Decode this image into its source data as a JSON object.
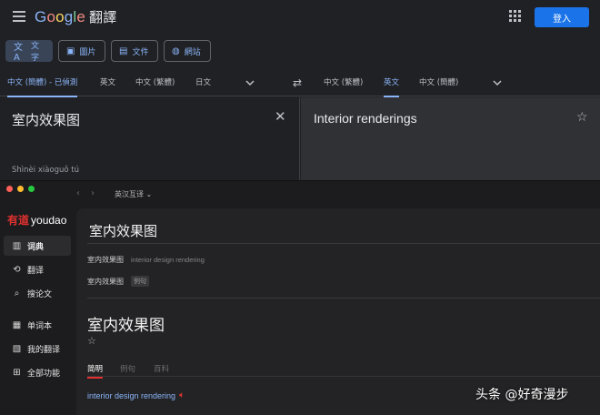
{
  "google": {
    "logo": {
      "g": "G",
      "o1": "o",
      "o2": "o",
      "g2": "g",
      "l": "l",
      "e": "e",
      "product": "翻譯"
    },
    "login_label": "登入",
    "modes": [
      {
        "label": "文字",
        "icon": "translate-icon",
        "active": true
      },
      {
        "label": "圖片",
        "icon": "image-icon",
        "active": false
      },
      {
        "label": "文件",
        "icon": "document-icon",
        "active": false
      },
      {
        "label": "網站",
        "icon": "globe-icon",
        "active": false
      }
    ],
    "source_langs": [
      "中文 (簡體) - 已偵測",
      "英文",
      "中文 (繁體)",
      "日文"
    ],
    "target_langs": [
      "中文 (繁體)",
      "英文",
      "中文 (簡體)"
    ],
    "source_text": "室内效果图",
    "pinyin": "Shìnèi xiàoguǒ tú",
    "target_text": "Interior renderings",
    "accent": "#8ab4f8"
  },
  "youdao": {
    "nav_mode": "英汉互译 ⌄",
    "logo": {
      "cn": "有道",
      "en": "youdao"
    },
    "sidebar": [
      {
        "label": "词典",
        "icon": "dictionary-icon",
        "selected": true
      },
      {
        "label": "翻译",
        "icon": "translate-icon",
        "selected": false
      },
      {
        "label": "搜论文",
        "icon": "search-paper-icon",
        "selected": false
      },
      {
        "label": "单词本",
        "icon": "wordbook-icon",
        "selected": false
      },
      {
        "label": "我的翻译",
        "icon": "my-translation-icon",
        "selected": false
      },
      {
        "label": "全部功能",
        "icon": "all-features-icon",
        "selected": false
      }
    ],
    "query": "室内效果图",
    "suggestions": [
      {
        "word": "室内效果图",
        "gloss": "interior design rendering",
        "tag": ""
      },
      {
        "word": "室内效果图",
        "gloss": "",
        "tag": "例句"
      }
    ],
    "headword": "室内效果图",
    "tabs": [
      "简明",
      "例句",
      "百科"
    ],
    "result": "interior design rendering",
    "brand_color": "#e0312f"
  },
  "watermark": "头条 @好奇漫步"
}
